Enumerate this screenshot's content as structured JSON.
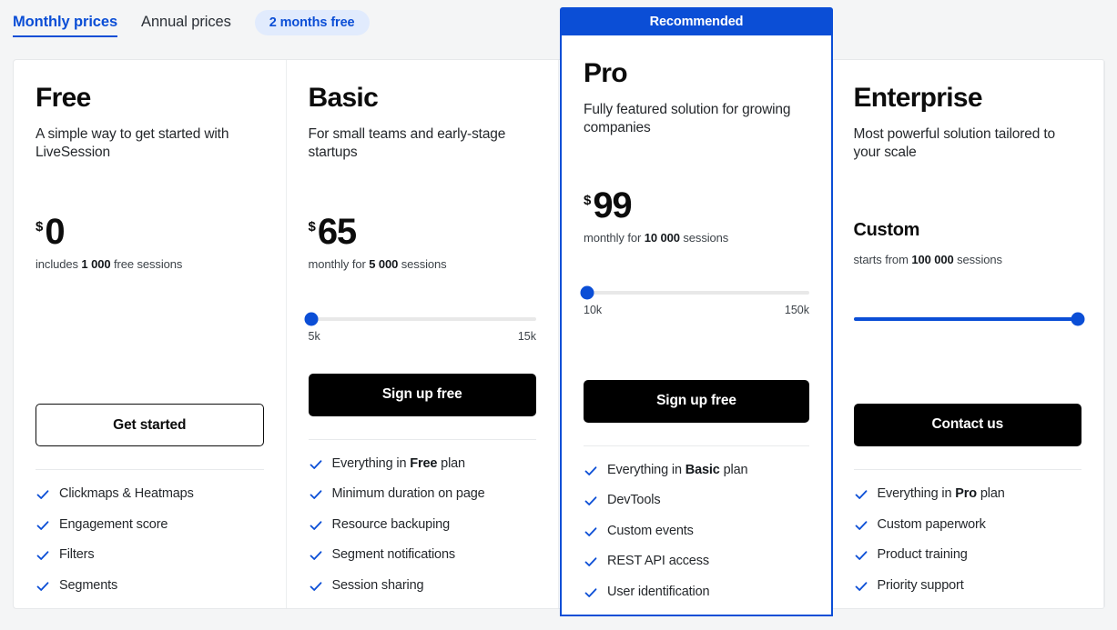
{
  "billing": {
    "tabs": [
      {
        "label": "Monthly prices",
        "active": true
      },
      {
        "label": "Annual prices",
        "active": false
      }
    ],
    "promo_badge": "2 months free"
  },
  "colors": {
    "brand_blue": "#0b4ed6",
    "badge_bg": "#e1ebfd",
    "cta_solid_bg": "#000000",
    "page_bg": "#f4f5f6",
    "card_bg": "#ffffff"
  },
  "plans": [
    {
      "name": "Free",
      "description": "A simple way to get started with LiveSession",
      "currency": "$",
      "amount": "0",
      "price_note_prefix": "includes ",
      "price_note_strong": "1 000",
      "price_note_suffix": " free sessions",
      "has_slider": false,
      "cta_label": "Get started",
      "cta_style": "outline",
      "features": [
        {
          "prefix": "Clickmaps & Heatmaps",
          "strong": "",
          "suffix": ""
        },
        {
          "prefix": "Engagement score",
          "strong": "",
          "suffix": ""
        },
        {
          "prefix": "Filters",
          "strong": "",
          "suffix": ""
        },
        {
          "prefix": "Segments",
          "strong": "",
          "suffix": ""
        }
      ]
    },
    {
      "name": "Basic",
      "description": "For small teams and early-stage startups",
      "currency": "$",
      "amount": "65",
      "price_note_prefix": "monthly for ",
      "price_note_strong": "5 000",
      "price_note_suffix": " sessions",
      "has_slider": true,
      "slider": {
        "min_label": "5k",
        "max_label": "15k",
        "value_percent": 0
      },
      "cta_label": "Sign up free",
      "cta_style": "solid",
      "features": [
        {
          "prefix": "Everything in ",
          "strong": "Free",
          "suffix": " plan"
        },
        {
          "prefix": "Minimum duration on page",
          "strong": "",
          "suffix": ""
        },
        {
          "prefix": "Resource backuping",
          "strong": "",
          "suffix": ""
        },
        {
          "prefix": "Segment notifications",
          "strong": "",
          "suffix": ""
        },
        {
          "prefix": "Session sharing",
          "strong": "",
          "suffix": ""
        }
      ]
    },
    {
      "name": "Pro",
      "ribbon_label": "Recommended",
      "description": "Fully featured solution for growing companies",
      "currency": "$",
      "amount": "99",
      "price_note_prefix": "monthly for ",
      "price_note_strong": "10 000",
      "price_note_suffix": " sessions",
      "has_slider": true,
      "slider": {
        "min_label": "10k",
        "max_label": "150k",
        "value_percent": 0
      },
      "cta_label": "Sign up free",
      "cta_style": "solid",
      "features": [
        {
          "prefix": "Everything in ",
          "strong": "Basic",
          "suffix": " plan"
        },
        {
          "prefix": "DevTools",
          "strong": "",
          "suffix": ""
        },
        {
          "prefix": "Custom events",
          "strong": "",
          "suffix": ""
        },
        {
          "prefix": "REST API access",
          "strong": "",
          "suffix": ""
        },
        {
          "prefix": "User identification",
          "strong": "",
          "suffix": ""
        }
      ]
    },
    {
      "name": "Enterprise",
      "description": "Most powerful solution tailored to your scale",
      "currency": "",
      "amount": "Custom",
      "price_note_prefix": "starts from ",
      "price_note_strong": "100 000",
      "price_note_suffix": " sessions",
      "has_slider": true,
      "slider": {
        "min_label": "",
        "max_label": "",
        "value_percent": 100
      },
      "cta_label": "Contact us",
      "cta_style": "solid",
      "features": [
        {
          "prefix": "Everything in ",
          "strong": "Pro",
          "suffix": " plan"
        },
        {
          "prefix": "Custom paperwork",
          "strong": "",
          "suffix": ""
        },
        {
          "prefix": "Product training",
          "strong": "",
          "suffix": ""
        },
        {
          "prefix": "Priority support",
          "strong": "",
          "suffix": ""
        }
      ]
    }
  ]
}
